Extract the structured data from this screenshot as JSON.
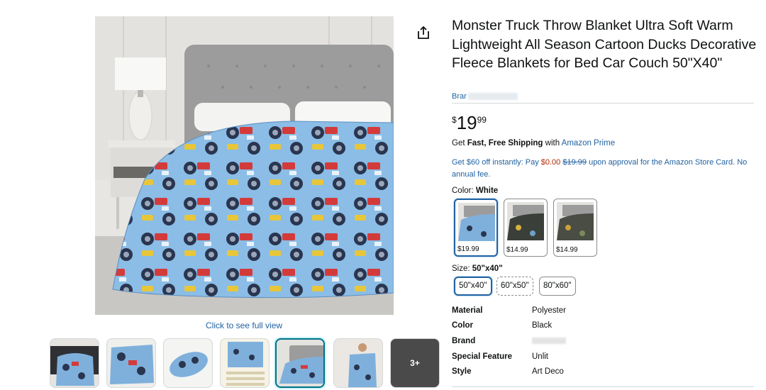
{
  "product": {
    "title": "Monster Truck Throw Blanket Ultra Soft Warm Lightweight All Season Cartoon Ducks Decorative Fleece Blankets for Bed Car Couch 50\"X40\"",
    "brand_prefix": "Brar",
    "price_symbol": "$",
    "price_whole": "19",
    "price_fraction": "99"
  },
  "gallery": {
    "full_view_label": "Click to see full view",
    "more_label": "3+",
    "thumbnails": [
      {
        "name": "blanket-on-sofa"
      },
      {
        "name": "blanket-folded"
      },
      {
        "name": "blanket-rolled"
      },
      {
        "name": "size-chart"
      },
      {
        "name": "blanket-on-bed"
      },
      {
        "name": "person-with-blanket"
      }
    ]
  },
  "shipping": {
    "prefix": "Get ",
    "bold": "Fast, Free Shipping",
    "middle": " with ",
    "prime": "Amazon Prime"
  },
  "offer": {
    "part1": "Get $60 off instantly: Pay ",
    "pay": "$0.00",
    "strike": "$19.99",
    "part2": " upon approval for the Amazon Store Card. No annual fee."
  },
  "color": {
    "label": "Color: ",
    "selected": "White",
    "options": [
      {
        "price": "$19.99",
        "swatch": "#7fb0dc"
      },
      {
        "price": "$14.99",
        "swatch": "#3a3f3a"
      },
      {
        "price": "$14.99",
        "swatch": "#4a4d44"
      }
    ]
  },
  "size": {
    "label": "Size: ",
    "selected": "50\"x40\"",
    "options": [
      "50\"x40\"",
      "60\"x50\"",
      "80\"x60\""
    ]
  },
  "specs": [
    {
      "key": "Material",
      "value": "Polyester"
    },
    {
      "key": "Color",
      "value": "Black"
    },
    {
      "key": "Brand",
      "value": ""
    },
    {
      "key": "Special Feature",
      "value": "Unlit"
    },
    {
      "key": "Style",
      "value": "Art Deco"
    }
  ],
  "colors": {
    "link": "#2162a1",
    "price_red": "#b12704",
    "selected_border": "#2162a1",
    "blanket_blue": "#7fb0dc"
  },
  "icons": {
    "share": "share-icon"
  }
}
